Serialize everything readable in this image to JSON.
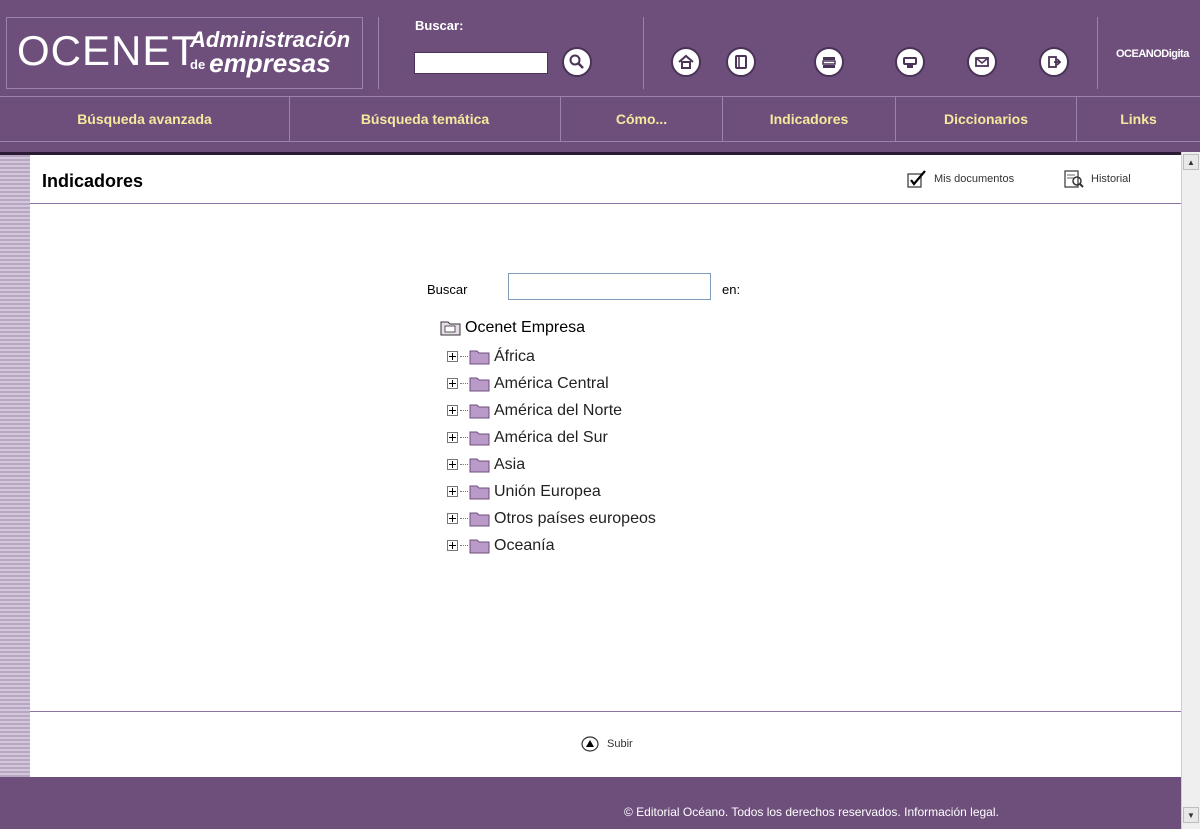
{
  "header": {
    "logo_main": "OCENET",
    "logo_line1": "Administración",
    "logo_prefix": "de",
    "logo_line2": "empresas",
    "search_label": "Buscar:",
    "search_value": "",
    "brand_right": "OCEANODigita",
    "icons": [
      "search-icon",
      "home-icon",
      "book-icon",
      "books-icon",
      "print-icon",
      "mail-icon",
      "exit-icon"
    ]
  },
  "nav": {
    "items": [
      "Búsqueda avanzada",
      "Búsqueda temática",
      "Cómo...",
      "Indicadores",
      "Diccionarios",
      "Links"
    ]
  },
  "page": {
    "title": "Indicadores",
    "mis_documentos": "Mis documentos",
    "historial": "Historial",
    "search_label": "Buscar",
    "search_value": "",
    "en_label": "en:"
  },
  "tree": {
    "root": "Ocenet Empresa",
    "items": [
      "África",
      "América Central",
      "América del Norte",
      "América del Sur",
      "Asia",
      "Unión Europea",
      "Otros países europeos",
      "Oceanía"
    ]
  },
  "bottom": {
    "subir": "Subir"
  },
  "footer": {
    "copyright": "© Editorial Océano. Todos los derechos reservados.",
    "legal_link": "Información legal."
  },
  "colors": {
    "brand_purple": "#6e4f7c",
    "nav_text": "#f7e89e",
    "folder": "#b99ac9"
  }
}
